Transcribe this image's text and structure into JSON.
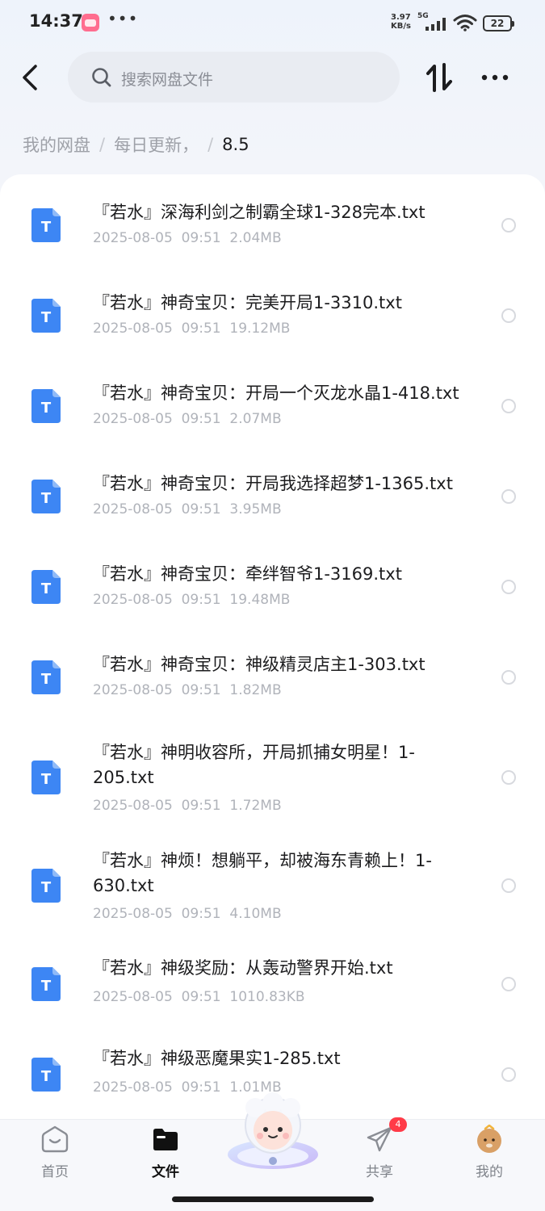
{
  "status_bar": {
    "time": "14:37",
    "speed_value": "3.97",
    "speed_unit": "KB/s",
    "network": "5G",
    "battery": "22"
  },
  "header": {
    "search_placeholder": "搜索网盘文件"
  },
  "breadcrumb": {
    "items": [
      "我的网盘",
      "每日更新，"
    ],
    "separator": "/",
    "current": "8.5"
  },
  "files": [
    {
      "name": "『若水』深海利剑之制霸全球1-328完本.txt",
      "date": "2025-08-05",
      "time": "09:51",
      "size": "2.04MB"
    },
    {
      "name": "『若水』神奇宝贝：完美开局1-3310.txt",
      "date": "2025-08-05",
      "time": "09:51",
      "size": "19.12MB"
    },
    {
      "name": "『若水』神奇宝贝：开局一个灭龙水晶1-418.txt",
      "date": "2025-08-05",
      "time": "09:51",
      "size": "2.07MB"
    },
    {
      "name": "『若水』神奇宝贝：开局我选择超梦1-1365.txt",
      "date": "2025-08-05",
      "time": "09:51",
      "size": "3.95MB"
    },
    {
      "name": "『若水』神奇宝贝：牵绊智爷1-3169.txt",
      "date": "2025-08-05",
      "time": "09:51",
      "size": "19.48MB"
    },
    {
      "name": "『若水』神奇宝贝：神级精灵店主1-303.txt",
      "date": "2025-08-05",
      "time": "09:51",
      "size": "1.82MB"
    },
    {
      "name": "『若水』神明收容所，开局抓捕女明星！1-205.txt",
      "date": "2025-08-05",
      "time": "09:51",
      "size": "1.72MB"
    },
    {
      "name": "『若水』神烦！想躺平，却被海东青赖上！1-630.txt",
      "date": "2025-08-05",
      "time": "09:51",
      "size": "4.10MB"
    },
    {
      "name": "『若水』神级奖励：从轰动警界开始.txt",
      "date": "2025-08-05",
      "time": "09:51",
      "size": "1010.83KB"
    },
    {
      "name": "『若水』神级恶魔果实1-285.txt",
      "date": "2025-08-05",
      "time": "09:51",
      "size": "1.01MB"
    }
  ],
  "file_icon_letter": "T",
  "colors": {
    "file_icon": "#3d86f4",
    "badge": "#ff3b48",
    "active_tab": "#111111"
  },
  "bottom_nav": {
    "items": [
      {
        "label": "首页",
        "icon": "home-icon"
      },
      {
        "label": "文件",
        "icon": "folder-icon",
        "active": true
      },
      {
        "label": "共享",
        "icon": "send-icon",
        "badge": "4"
      },
      {
        "label": "我的",
        "icon": "avatar-icon"
      }
    ]
  }
}
